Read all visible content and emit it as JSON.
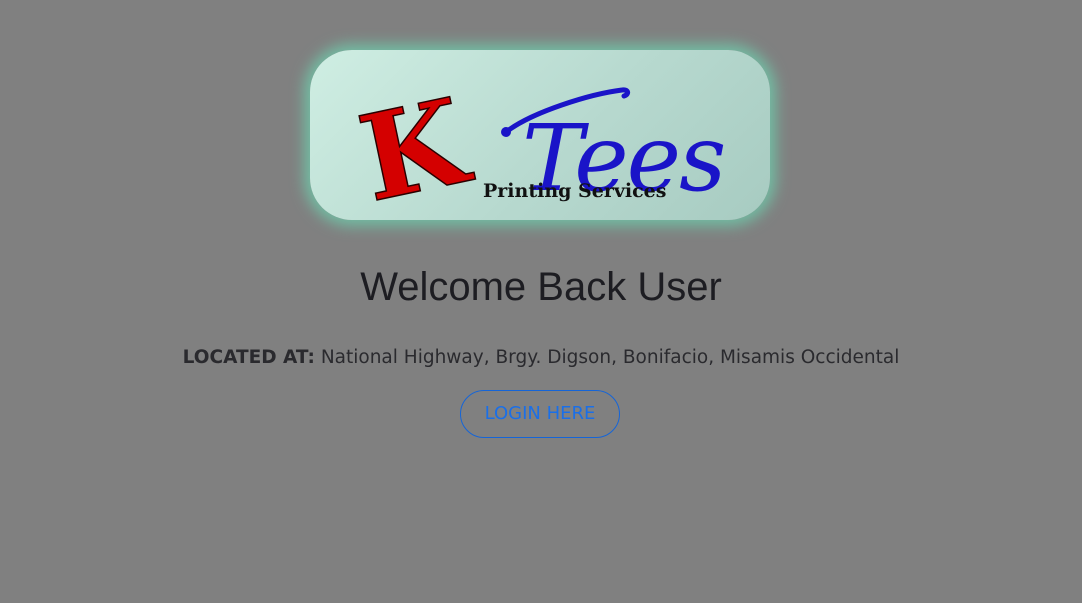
{
  "logo": {
    "initial": "K",
    "word": "Tees",
    "tagline": "Printing Services",
    "colors": {
      "initial": "#d40000",
      "word": "#1a14c8",
      "tagline": "#111111"
    }
  },
  "heading": "Welcome Back User",
  "location": {
    "label": "LOCATED AT:",
    "address": "National Highway, Brgy. Digson, Bonifacio, Misamis Occidental"
  },
  "login_button": "LOGIN HERE",
  "theme": {
    "background": "#808080",
    "accent": "#1a6fe8",
    "glow": "#6ed2af"
  }
}
